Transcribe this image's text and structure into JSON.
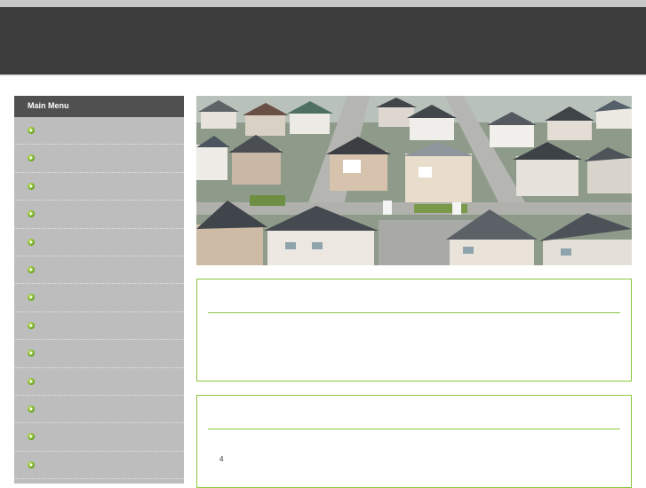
{
  "sidebar": {
    "title": "Main Menu",
    "item_count": 13
  },
  "content": {
    "box2_text": "4"
  },
  "colors": {
    "header": "#3c3c3c",
    "sidebar_bg": "#bdbdbd",
    "sidebar_title_bg": "#505050",
    "accent_green": "#8cc63f"
  }
}
